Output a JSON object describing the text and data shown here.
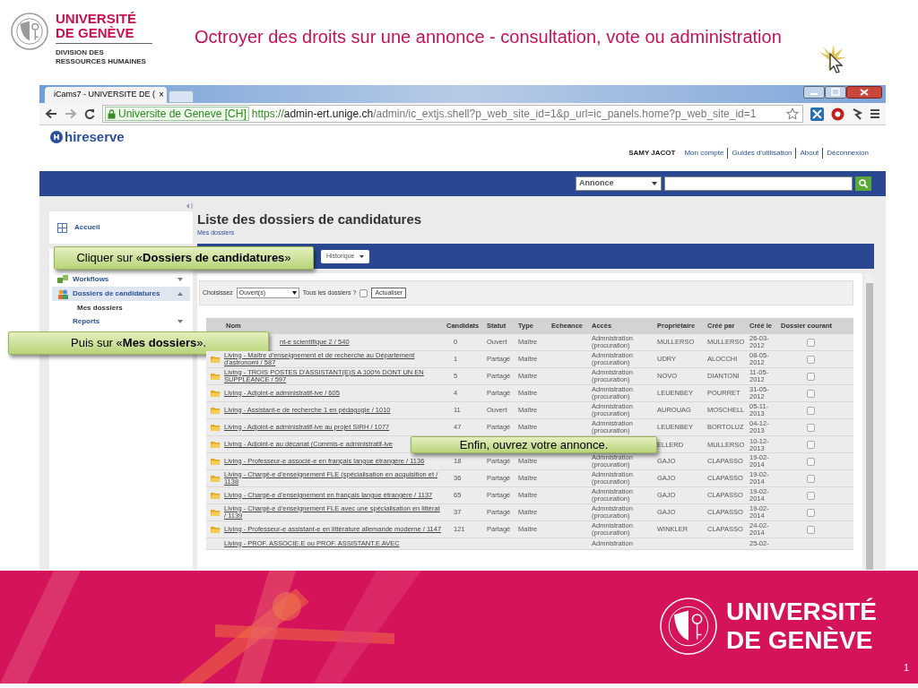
{
  "slide": {
    "title": "Octroyer des droits sur une annonce - consultation, vote ou administration",
    "logo": {
      "line1": "UNIVERSITÉ",
      "line2": "DE GENÈVE",
      "sub1": "DIVISION DES",
      "sub2": "RESSOURCES HUMAINES"
    },
    "footer_logo": {
      "line1": "UNIVERSITÉ",
      "line2": "DE GENÈVE"
    },
    "page_number": "1"
  },
  "browser": {
    "tabs": [
      {
        "label": "iCams7 - UNIVERSITE DE (",
        "close": "×",
        "selected": true
      }
    ],
    "security_label": "Universite de Geneve [CH]",
    "url_scheme": "https://",
    "url_host": "admin-ert.unige.ch",
    "url_path": "/admin/ic_extjs.shell?p_web_site_id=1&p_url=ic_panels.home?p_web_site_id=1"
  },
  "app": {
    "brand": "hireserve",
    "user": "SAMY JACOT",
    "header_links": [
      "Mon compte",
      "Guides d'utilisation",
      "About",
      "Déconnexion"
    ],
    "nav_select": "Annonce",
    "home": "Accueil",
    "sidebar": {
      "items": [
        {
          "label": "Workflows",
          "kind": "workflow",
          "expanded": false,
          "selected": false
        },
        {
          "label": "Dossiers de candidatures",
          "kind": "folders",
          "expanded": true,
          "selected": true,
          "children": [
            {
              "label": "Mes dossiers"
            }
          ]
        },
        {
          "label": "Reports",
          "kind": "plain",
          "expanded": false,
          "selected": false
        }
      ]
    },
    "page_title": "Liste des dossiers de candidatures",
    "breadcrumb": "Mes dossiers",
    "toolbar": {
      "button": "Historique",
      "callout": "Cliquer sur «**Dossiers de candidatures**»"
    },
    "filter": {
      "label": "Choisissez",
      "select": "Ouvert(s)",
      "all_label": "Tous les dossiers ?",
      "all_checked": false,
      "button": "Actualiser"
    },
    "table": {
      "columns": [
        "Nom",
        "Candidats",
        "Statut",
        "Type",
        "Echeance",
        "Accès",
        "Propriétaire",
        "Créé par",
        "Créé le",
        "Dossier courant"
      ],
      "rows": [
        {
          "name": "nt-e scientifique 2 / 540",
          "folder_icon": false,
          "callout_before": "Puis sur «**Mes dossiers**».",
          "candidats": "0",
          "statut": "Ouvert",
          "type": "Maître",
          "acces": "Admnistration (procuration)",
          "proprietaire": "MULLERSO",
          "cree_par": "MULLERSO",
          "cree_le": "26-03-2012",
          "checked": false
        },
        {
          "name": "Living - Maître d'enseignement et de recherche au Département d'astronomi / 587",
          "folder_icon": true,
          "candidats": "1",
          "statut": "Partagé",
          "type": "Maître",
          "acces": "Admnistration (procuration)",
          "proprietaire": "UDRY",
          "cree_par": "ALOCCHI",
          "cree_le": "08-05-2012",
          "checked": false
        },
        {
          "name": "Living - TROIS POSTES D'ASSISTANT(E)S A 100% DONT UN EN SUPPLÉANCE / 597",
          "folder_icon": true,
          "candidats": "5",
          "statut": "Partagé",
          "type": "Maître",
          "acces": "Admnistration (procuration)",
          "proprietaire": "NOVO",
          "cree_par": "DIANTONI",
          "cree_le": "11-05-2012",
          "checked": false
        },
        {
          "name": "Living - Adjoint-e administratif-ive / 605",
          "folder_icon": true,
          "candidats": "4",
          "statut": "Partagé",
          "type": "Maître",
          "acces": "Admnistration (procuration)",
          "proprietaire": "LEUENBEY",
          "cree_par": "POURRET",
          "cree_le": "31-05-2012",
          "checked": false
        },
        {
          "name": "Living - Assistant-e de recherche 1 en pédagogie / 1010",
          "folder_icon": true,
          "candidats": "11",
          "statut": "Ouvert",
          "type": "Maître",
          "acces": "Admnistration (procuration)",
          "proprietaire": "AUROUAG",
          "cree_par": "MOSCHELL",
          "cree_le": "05-11-2013",
          "checked": false
        },
        {
          "name": "Living - Adjoint-e administratif-ive au projet SIRH / 1077",
          "folder_icon": true,
          "candidats": "47",
          "statut": "Partagé",
          "type": "Maître",
          "acces": "Admnistration (procuration)",
          "proprietaire": "LEUENBEY",
          "cree_par": "BORTOLUZ",
          "cree_le": "04-12-2013",
          "checked": false
        },
        {
          "name": "Living - Adjoint-e au décanat (Commis-e administratif-ive",
          "folder_icon": true,
          "callout_after": "Enfin, ouvrez votre annonce.",
          "proprietaire": "ELLERD",
          "cree_par": "MULLERSO",
          "cree_le": "10-12-2013",
          "checked": false
        },
        {
          "name": "Living - Professeur-e associé-e en français langue étrangère / 1136",
          "folder_icon": true,
          "candidats": "18",
          "statut": "Partagé",
          "type": "Maître",
          "acces": "Admnistration (procuration)",
          "proprietaire": "GAJO",
          "cree_par": "CLAPASSO",
          "cree_le": "19-02-2014",
          "checked": false
        },
        {
          "name": "Living - Chargé-e d'enseignement FLE (spécialisation en acquisition et / 1138",
          "folder_icon": true,
          "candidats": "36",
          "statut": "Partagé",
          "type": "Maître",
          "acces": "Admnistration (procuration)",
          "proprietaire": "GAJO",
          "cree_par": "CLAPASSO",
          "cree_le": "19-02-2014",
          "checked": false
        },
        {
          "name": "Living - Chargé-e d'enseignement en français langue étrangère / 1137",
          "folder_icon": true,
          "candidats": "65",
          "statut": "Partagé",
          "type": "Maître",
          "acces": "Admnistration (procuration)",
          "proprietaire": "GAJO",
          "cree_par": "CLAPASSO",
          "cree_le": "19-02-2014",
          "checked": false
        },
        {
          "name": "Living - Chargé-e d'enseignement FLE avec une spécialisation en littérat / 1139",
          "folder_icon": true,
          "candidats": "37",
          "statut": "Partagé",
          "type": "Maître",
          "acces": "Admnistration (procuration)",
          "proprietaire": "GAJO",
          "cree_par": "CLAPASSO",
          "cree_le": "19-02-2014",
          "checked": false
        },
        {
          "name": "Living - Professeur-e assistant-e en littérature allemande moderne / 1147",
          "folder_icon": true,
          "candidats": "121",
          "statut": "Partagé",
          "type": "Maître",
          "acces": "Admnistration (procuration)",
          "proprietaire": "WINKLER",
          "cree_par": "CLAPASSO",
          "cree_le": "24-02-2014",
          "checked": false
        },
        {
          "name": "Living - PROF. ASSOCIE.E ou PROF. ASSISTANT.E AVEC",
          "folder_icon": false,
          "acces": "Admnistration",
          "cree_le": "25-02-"
        }
      ]
    }
  }
}
